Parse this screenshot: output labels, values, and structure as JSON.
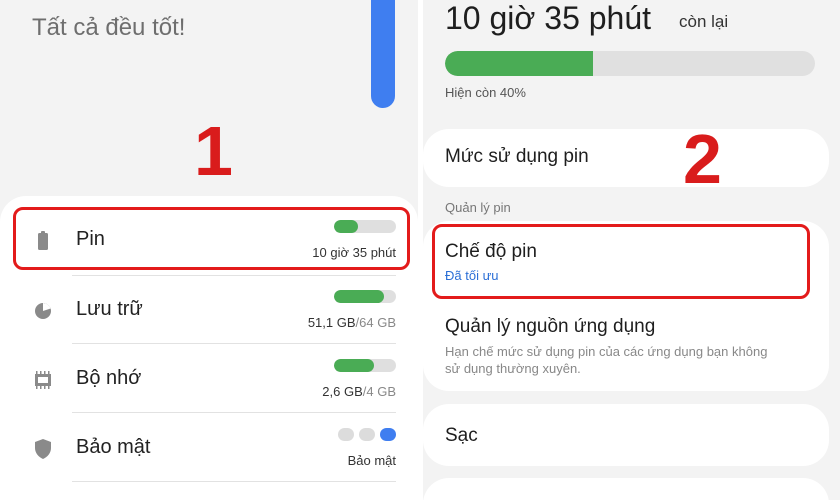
{
  "left": {
    "status_title": "Tất cả đều tốt!",
    "step_number": "1",
    "items": [
      {
        "label": "Pin",
        "value": "10 giờ 35 phút",
        "progress": 0.38,
        "icon": "battery-icon"
      },
      {
        "label": "Lưu trữ",
        "value": "51,1 GB",
        "value_total": "/64 GB",
        "progress": 0.8,
        "icon": "storage-icon"
      },
      {
        "label": "Bộ nhớ",
        "value": "2,6 GB",
        "value_total": "/4 GB",
        "progress": 0.65,
        "icon": "memory-icon"
      },
      {
        "label": "Bảo mật",
        "value": "Bảo mật",
        "icon": "shield-icon"
      }
    ]
  },
  "right": {
    "battery_time": "10 giờ 35 phút",
    "battery_time_suffix": "còn lại",
    "battery_level": 0.4,
    "battery_percent_text": "Hiện còn 40%",
    "step_number": "2",
    "usage_label": "Mức sử dụng pin",
    "section_header": "Quản lý pin",
    "power_mode_label": "Chế độ pin",
    "power_mode_value": "Đã tối ưu",
    "app_manage_label": "Quản lý nguồn ứng dụng",
    "app_manage_desc": "Hạn chế mức sử dụng pin của các ứng dụng bạn không sử dụng thường xuyên.",
    "charging_label": "Sạc"
  },
  "colors": {
    "accent_blue": "#3f7ef0",
    "progress_green": "#4aac55",
    "highlight_red": "#e31b1b",
    "step_red": "#d91c1c"
  }
}
